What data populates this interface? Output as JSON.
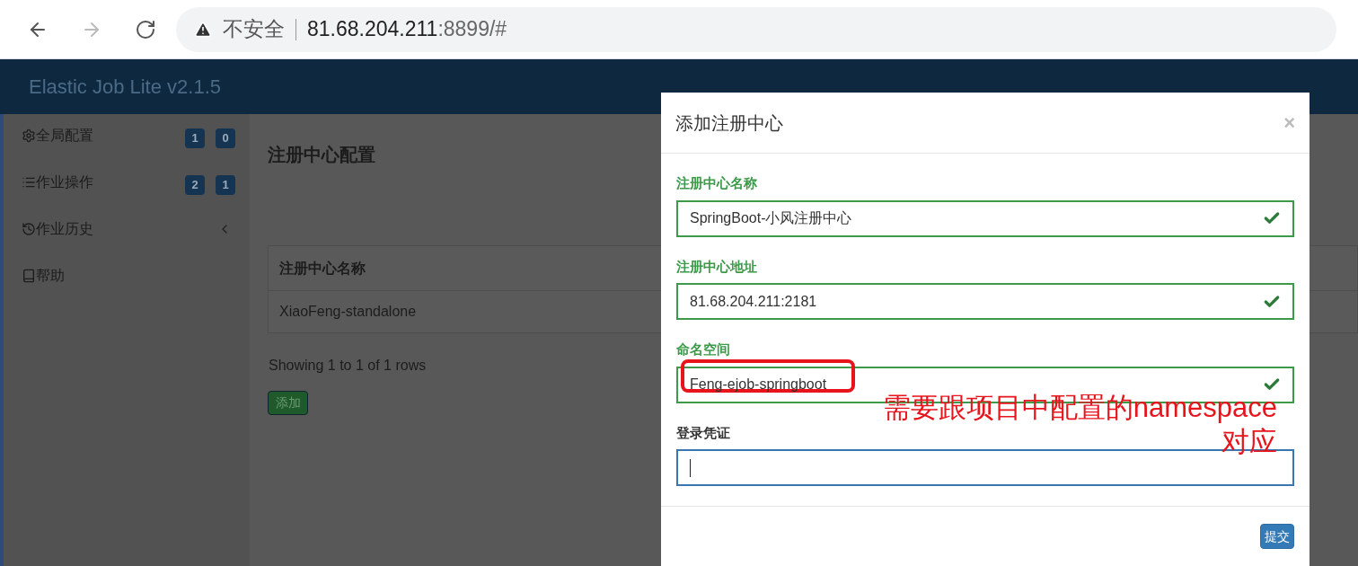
{
  "browser": {
    "security_label": "不安全",
    "url_host": "81.68.204.211",
    "url_rest": ":8899/#"
  },
  "app_title": "Elastic Job Lite v2.1.5",
  "sidebar": {
    "items": [
      {
        "kind": "badges",
        "label": "全局配置",
        "badges": [
          "1",
          "0"
        ]
      },
      {
        "kind": "badges",
        "label": "作业操作",
        "badges": [
          "2",
          "1"
        ]
      },
      {
        "kind": "submenu",
        "label": "作业历史",
        "expanded": false
      },
      {
        "kind": "plain",
        "label": "帮助"
      }
    ]
  },
  "main": {
    "title": "注册中心配置",
    "table": {
      "columns": [
        "注册中心名称"
      ],
      "rows": [
        [
          "XiaoFeng-standalone"
        ]
      ]
    },
    "pagination": "Showing 1 to 1 of 1 rows",
    "add_button": "添加"
  },
  "modal": {
    "title": "添加注册中心",
    "close": "×",
    "fields": [
      {
        "label": "注册中心名称",
        "value": "SpringBoot-小风注册中心",
        "valid": true,
        "focused": false
      },
      {
        "label": "注册中心地址",
        "value": "81.68.204.211:2181",
        "valid": true,
        "focused": false
      },
      {
        "label": "命名空间",
        "value": "Feng-ejob-springboot",
        "valid": true,
        "focused": false
      },
      {
        "label": "登录凭证",
        "valid": false,
        "focused": true
      }
    ],
    "submit": "提交"
  },
  "annotation": {
    "line_1": "需要跟项目中配置的namespace",
    "line_2": "对应"
  }
}
